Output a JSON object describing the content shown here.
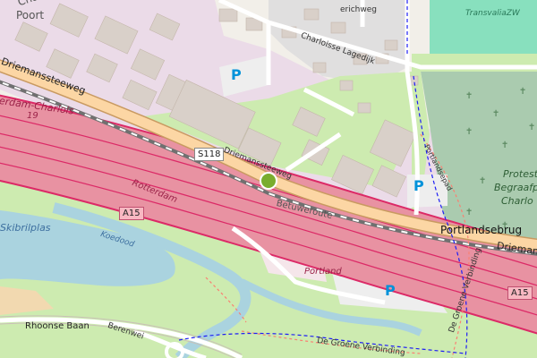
{
  "map": {
    "labels": {
      "top_left_upper": "Charloisse",
      "top_left_lower": "Poort",
      "driemanssteeweg_west": "Driemanssteeweg",
      "driemanssteeweg_center": "Driemanssteeweg",
      "driemanssteeweg_east": "Driemans",
      "highway_top_label": "erdam-Charlois",
      "highway_top_number": "19",
      "s118": "S118",
      "a15_west": "A15",
      "a15_east": "A15",
      "rotterdam_italic": "Rotterdam",
      "betuweroute": "Betuweroute",
      "portlandsebrug": "Portlandsebrug",
      "portland": "Portland",
      "charloisse_lagedijk": "Charloisse Lagedijk",
      "erichweg": "erichweg",
      "transvalia": "TransvaliaZW",
      "skibrilplas": "Skibrilplas",
      "koedood": "Koedood",
      "rhoonse_baan": "Rhoonse Baan",
      "berenwei": "Berenwei",
      "de_groene_verbinding_h": "De Groene Verbinding",
      "de_groene_verbinding_v": "De Groene Verbinding",
      "portlandsepad": "Portlandsepad",
      "protestants_1": "Protesta",
      "protestants_2": "Begraafp",
      "protestants_3": "Charlo"
    },
    "parking_symbol": "P",
    "colors": {
      "motorway": "#e892a2",
      "motorway_casing": "#dc2a67",
      "primary": "#fcd6a4",
      "secondary": "#f7fabf",
      "industrial": "#ebdbe8",
      "grass": "#cdebb0",
      "water": "#aad3df",
      "building": "#d9d0c9",
      "sports": "#88e0be",
      "cemetery": "#aacbaf",
      "parking": "#eeeeee",
      "marker": "#7aad2e",
      "parking_icon": "#0092da"
    }
  }
}
